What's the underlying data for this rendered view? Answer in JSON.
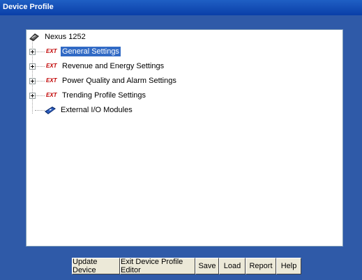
{
  "window": {
    "title": "Device Profile"
  },
  "tree": {
    "root": {
      "label": "Nexus 1252",
      "icon": "nexus-device-icon"
    },
    "items": [
      {
        "label": "General Settings",
        "icon": "ext-settings-icon",
        "selected": true,
        "expandable": true
      },
      {
        "label": "Revenue and Energy Settings",
        "icon": "ext-settings-icon",
        "selected": false,
        "expandable": true
      },
      {
        "label": "Power Quality and Alarm Settings",
        "icon": "ext-settings-icon",
        "selected": false,
        "expandable": true
      },
      {
        "label": "Trending Profile Settings",
        "icon": "ext-settings-icon",
        "selected": false,
        "expandable": true
      },
      {
        "label": "External I/O Modules",
        "icon": "io-module-icon",
        "selected": false,
        "expandable": false
      }
    ]
  },
  "buttons": {
    "update_device": "Update Device",
    "exit_editor": "Exit Device Profile Editor",
    "save": "Save",
    "load": "Load",
    "report": "Report",
    "help": "Help"
  },
  "colors": {
    "title_bar": "#0a3fa8",
    "frame": "#2f5aa8",
    "selection": "#316ac5"
  }
}
